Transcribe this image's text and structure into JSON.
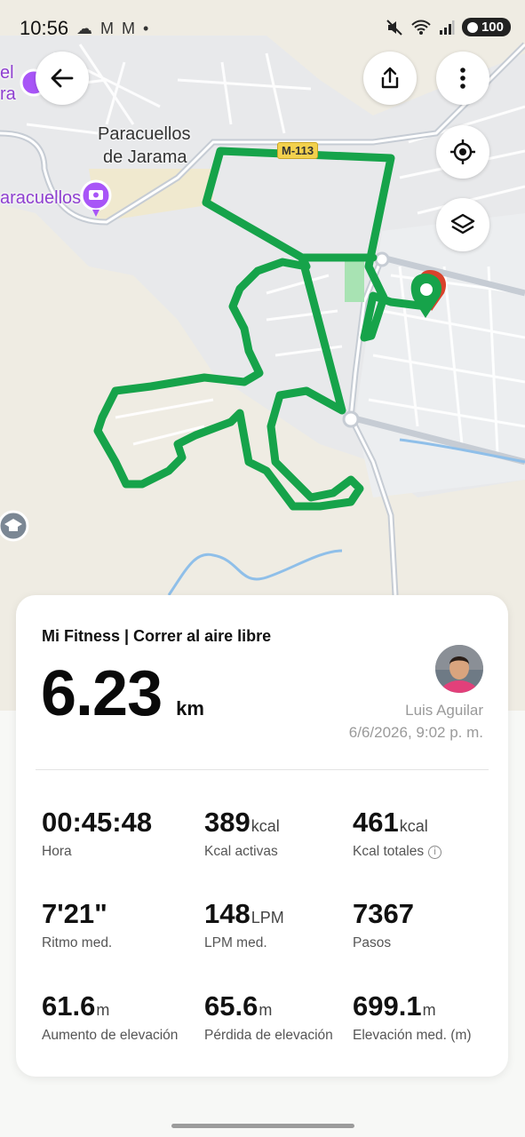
{
  "status_bar": {
    "time": "10:56",
    "notification_icons": "☁ M M •",
    "battery": "100",
    "icons": [
      "cloud-icon",
      "gmail-icon",
      "gmail-icon",
      "dot-icon",
      "mute-icon",
      "wifi-icon",
      "signal-icon",
      "battery-icon"
    ]
  },
  "map": {
    "labels": {
      "town_line1": "Paracuellos",
      "town_line2": "de Jarama",
      "poi_left": "aracuellos",
      "poi_topleft_line1": "el",
      "poi_topleft_line2": "ra",
      "road": "M-113"
    },
    "colors": {
      "route": "#16a34a",
      "land": "#efece3",
      "urban": "#e7e8ea",
      "water": "#7fb3e6",
      "poi": "#a855f7"
    },
    "buttons": [
      "back-icon",
      "share-icon",
      "more-icon",
      "locate-icon",
      "layers-icon"
    ]
  },
  "summary": {
    "title": "Mi Fitness | Correr al aire libre",
    "distance_value": "6.23",
    "distance_unit": "km",
    "user_name": "Luis Aguilar",
    "datetime": "6/6/2026, 9:02 p. m."
  },
  "metrics": [
    {
      "value": "00:45:48",
      "unit": "",
      "label": "Hora"
    },
    {
      "value": "389",
      "unit": "kcal",
      "label": "Kcal activas"
    },
    {
      "value": "461",
      "unit": "kcal",
      "label": "Kcal totales"
    },
    {
      "value": "7'21\"",
      "unit": "",
      "label": "Ritmo med."
    },
    {
      "value": "148",
      "unit": "LPM",
      "label": "LPM med."
    },
    {
      "value": "7367",
      "unit": "",
      "label": "Pasos"
    },
    {
      "value": "61.6",
      "unit": "m",
      "label": "Aumento de elevación"
    },
    {
      "value": "65.6",
      "unit": "m",
      "label": "Pérdida de elevación"
    },
    {
      "value": "699.1",
      "unit": "m",
      "label": "Elevación med. (m)"
    }
  ]
}
